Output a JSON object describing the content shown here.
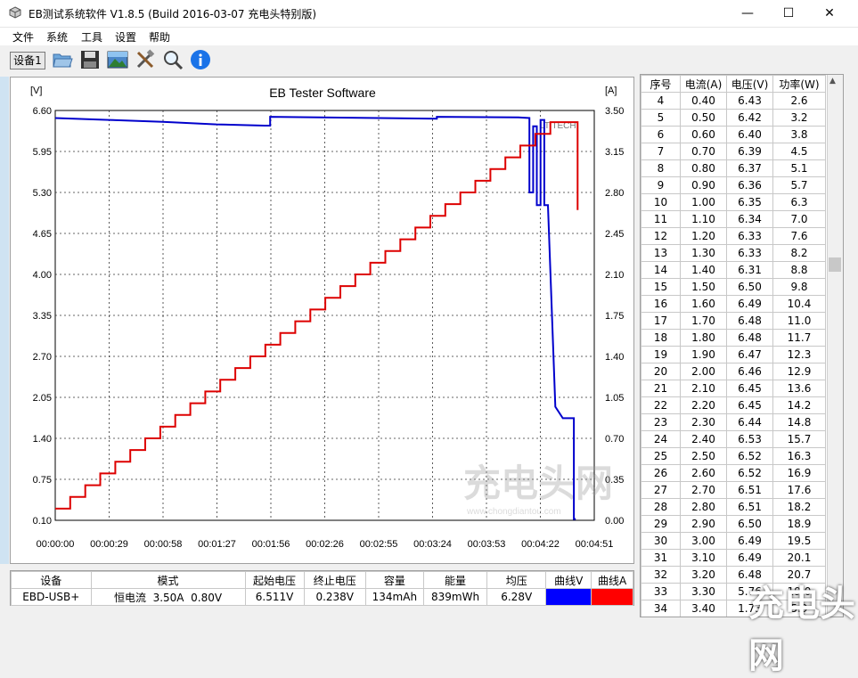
{
  "window": {
    "title": "EB测试系统软件 V1.8.5 (Build 2016-03-07 充电头特别版)",
    "minimize": "—",
    "maximize": "☐",
    "close": "✕"
  },
  "menu": [
    "文件",
    "系统",
    "工具",
    "设置",
    "帮助"
  ],
  "toolbar": {
    "device_tab": "设备1",
    "icons": [
      "open-folder-icon",
      "save-icon",
      "image-icon",
      "tools-icon",
      "search-icon",
      "info-icon"
    ]
  },
  "chart_data": {
    "type": "line",
    "title": "EB Tester Software",
    "left_unit": "[V]",
    "right_unit": "[A]",
    "left_ticks": [
      "6.60",
      "5.95",
      "5.30",
      "4.65",
      "4.00",
      "3.35",
      "2.70",
      "2.05",
      "1.40",
      "0.75",
      "0.10"
    ],
    "right_ticks": [
      "3.50",
      "3.15",
      "2.80",
      "2.45",
      "2.10",
      "1.75",
      "1.40",
      "1.05",
      "0.70",
      "0.35",
      "0.00"
    ],
    "x_ticks": [
      "00:00:00",
      "00:00:29",
      "00:00:58",
      "00:01:27",
      "00:01:56",
      "00:02:26",
      "00:02:55",
      "00:03:24",
      "00:03:53",
      "00:04:22",
      "00:04:51"
    ],
    "ylim_left": [
      0.1,
      6.6
    ],
    "ylim_right": [
      0.0,
      3.5
    ],
    "xlim": [
      0,
      291
    ],
    "grid": true,
    "watermark_text": "LT TECH",
    "watermark_logo_text": "充电头网",
    "watermark_url": "www.chongdiantou.com",
    "series": [
      {
        "name": "曲线V",
        "color": "#0000cc",
        "axis": "left",
        "x": [
          0,
          29,
          58,
          87,
          113,
          116,
          116,
          143,
          175,
          206,
          206,
          250,
          256,
          256,
          258,
          258,
          260,
          260,
          262,
          262,
          264,
          264,
          266,
          266,
          270,
          270,
          274,
          274,
          280,
          280,
          281
        ],
        "y": [
          6.48,
          6.45,
          6.42,
          6.38,
          6.36,
          6.36,
          6.5,
          6.49,
          6.48,
          6.47,
          6.5,
          6.49,
          6.48,
          5.3,
          5.3,
          6.35,
          6.35,
          5.1,
          5.1,
          6.45,
          6.45,
          5.1,
          5.1,
          5.1,
          1.9,
          1.9,
          1.72,
          1.72,
          1.72,
          0.12,
          0.12
        ]
      },
      {
        "name": "曲线A",
        "color": "#dd0000",
        "axis": "right",
        "steps": [
          0.1,
          0.2,
          0.3,
          0.4,
          0.5,
          0.6,
          0.7,
          0.8,
          0.9,
          1.0,
          1.1,
          1.2,
          1.3,
          1.4,
          1.5,
          1.6,
          1.7,
          1.8,
          1.9,
          2.0,
          2.1,
          2.2,
          2.3,
          2.4,
          2.5,
          2.6,
          2.7,
          2.8,
          2.9,
          3.0,
          3.1,
          3.2,
          3.3
        ],
        "step_seconds": 8.1,
        "peak": 3.4,
        "end_value": 2.65,
        "end_time": 282
      }
    ]
  },
  "table": {
    "headers": [
      "序号",
      "电流(A)",
      "电压(V)",
      "功率(W)"
    ],
    "rows": [
      [
        "4",
        "0.40",
        "6.43",
        "2.6"
      ],
      [
        "5",
        "0.50",
        "6.42",
        "3.2"
      ],
      [
        "6",
        "0.60",
        "6.40",
        "3.8"
      ],
      [
        "7",
        "0.70",
        "6.39",
        "4.5"
      ],
      [
        "8",
        "0.80",
        "6.37",
        "5.1"
      ],
      [
        "9",
        "0.90",
        "6.36",
        "5.7"
      ],
      [
        "10",
        "1.00",
        "6.35",
        "6.3"
      ],
      [
        "11",
        "1.10",
        "6.34",
        "7.0"
      ],
      [
        "12",
        "1.20",
        "6.33",
        "7.6"
      ],
      [
        "13",
        "1.30",
        "6.33",
        "8.2"
      ],
      [
        "14",
        "1.40",
        "6.31",
        "8.8"
      ],
      [
        "15",
        "1.50",
        "6.50",
        "9.8"
      ],
      [
        "16",
        "1.60",
        "6.49",
        "10.4"
      ],
      [
        "17",
        "1.70",
        "6.48",
        "11.0"
      ],
      [
        "18",
        "1.80",
        "6.48",
        "11.7"
      ],
      [
        "19",
        "1.90",
        "6.47",
        "12.3"
      ],
      [
        "20",
        "2.00",
        "6.46",
        "12.9"
      ],
      [
        "21",
        "2.10",
        "6.45",
        "13.6"
      ],
      [
        "22",
        "2.20",
        "6.45",
        "14.2"
      ],
      [
        "23",
        "2.30",
        "6.44",
        "14.8"
      ],
      [
        "24",
        "2.40",
        "6.53",
        "15.7"
      ],
      [
        "25",
        "2.50",
        "6.52",
        "16.3"
      ],
      [
        "26",
        "2.60",
        "6.52",
        "16.9"
      ],
      [
        "27",
        "2.70",
        "6.51",
        "17.6"
      ],
      [
        "28",
        "2.80",
        "6.51",
        "18.2"
      ],
      [
        "29",
        "2.90",
        "6.50",
        "18.9"
      ],
      [
        "30",
        "3.00",
        "6.49",
        "19.5"
      ],
      [
        "31",
        "3.10",
        "6.49",
        "20.1"
      ],
      [
        "32",
        "3.20",
        "6.48",
        "20.7"
      ],
      [
        "33",
        "3.30",
        "5.76",
        "19.0"
      ],
      [
        "34",
        "3.40",
        "1.73",
        "5.9"
      ]
    ]
  },
  "summary": {
    "headers": [
      "设备",
      "模式",
      "起始电压",
      "终止电压",
      "容量",
      "能量",
      "均压",
      "曲线V",
      "曲线A"
    ],
    "values": [
      "EBD-USB+",
      "恒电流  3.50A  0.80V",
      "6.511V",
      "0.238V",
      "134mAh",
      "839mWh",
      "6.28V",
      "",
      ""
    ],
    "curve_v_color": "#0000ff",
    "curve_a_color": "#ff0000"
  },
  "overlay_watermark": "充电头网"
}
